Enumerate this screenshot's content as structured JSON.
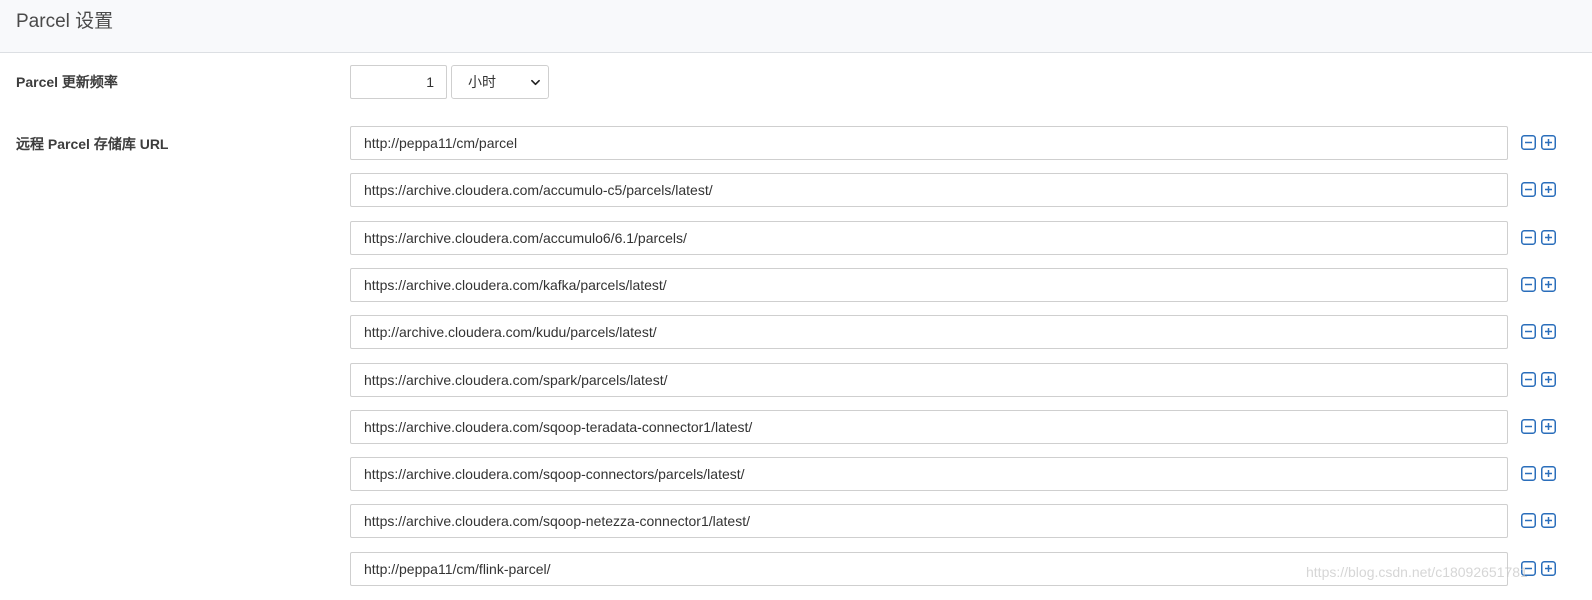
{
  "header": {
    "title": "Parcel 设置"
  },
  "update_frequency": {
    "label": "Parcel 更新频率",
    "value": "1",
    "unit_selected": "小时"
  },
  "repository": {
    "label": "远程 Parcel 存储库 URL",
    "urls": [
      "http://peppa11/cm/parcel",
      "https://archive.cloudera.com/accumulo-c5/parcels/latest/",
      "https://archive.cloudera.com/accumulo6/6.1/parcels/",
      "https://archive.cloudera.com/kafka/parcels/latest/",
      "http://archive.cloudera.com/kudu/parcels/latest/",
      "https://archive.cloudera.com/spark/parcels/latest/",
      "https://archive.cloudera.com/sqoop-teradata-connector1/latest/",
      "https://archive.cloudera.com/sqoop-connectors/parcels/latest/",
      "https://archive.cloudera.com/sqoop-netezza-connector1/latest/",
      "http://peppa11/cm/flink-parcel/"
    ]
  },
  "icons": {
    "remove": "minus-square-icon",
    "add": "plus-square-icon",
    "dropdown": "chevron-down-icon"
  },
  "colors": {
    "icon_blue": "#2a6ebb",
    "border": "#cfcfcf",
    "header_bg": "#f8f9fb"
  },
  "watermark": "https://blog.csdn.net/c18092651781"
}
